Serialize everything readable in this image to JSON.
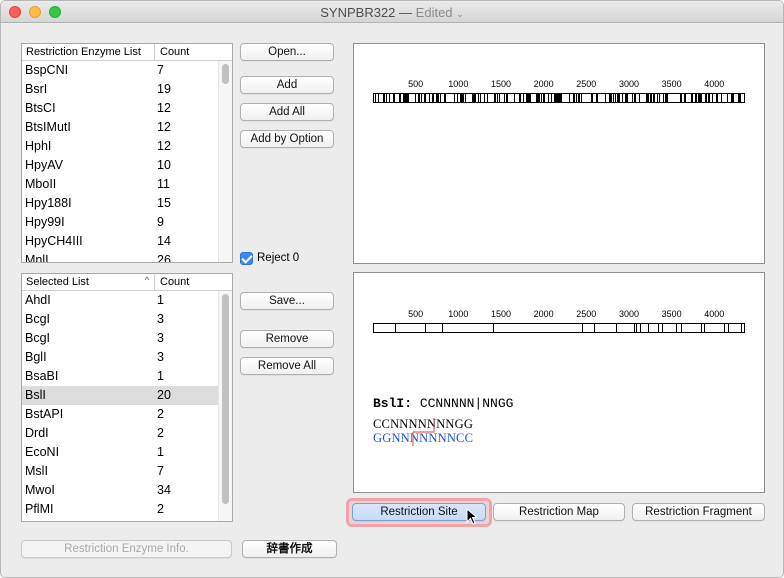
{
  "window": {
    "title": "SYNPBR322",
    "separator": "—",
    "status": "Edited",
    "status_chevron": "⌄"
  },
  "enzyme_list": {
    "headers": {
      "name": "Restriction Enzyme List",
      "count": "Count"
    },
    "rows": [
      {
        "name": "BspCNI",
        "count": "7"
      },
      {
        "name": "BsrI",
        "count": "19"
      },
      {
        "name": "BtsCI",
        "count": "12"
      },
      {
        "name": "BtsIMutI",
        "count": "12"
      },
      {
        "name": "HphI",
        "count": "12"
      },
      {
        "name": "HpyAV",
        "count": "10"
      },
      {
        "name": "MboII",
        "count": "11"
      },
      {
        "name": "Hpy188I",
        "count": "15"
      },
      {
        "name": "Hpy99I",
        "count": "9"
      },
      {
        "name": "HpyCH4III",
        "count": "14"
      },
      {
        "name": "MnlI",
        "count": "26"
      }
    ]
  },
  "selected_list": {
    "headers": {
      "name": "Selected List",
      "count": "Count",
      "sort_icon": "^"
    },
    "selected_index": 5,
    "rows": [
      {
        "name": "AhdI",
        "count": "1"
      },
      {
        "name": "BcgI",
        "count": "3"
      },
      {
        "name": "BcgI",
        "count": "3"
      },
      {
        "name": "BglI",
        "count": "3"
      },
      {
        "name": "BsaBI",
        "count": "1"
      },
      {
        "name": "BslI",
        "count": "20"
      },
      {
        "name": "BstAPI",
        "count": "2"
      },
      {
        "name": "DrdI",
        "count": "2"
      },
      {
        "name": "EcoNI",
        "count": "1"
      },
      {
        "name": "MslI",
        "count": "7"
      },
      {
        "name": "MwoI",
        "count": "34"
      },
      {
        "name": "PflMI",
        "count": "2"
      }
    ]
  },
  "buttons": {
    "open": "Open...",
    "add": "Add",
    "add_all": "Add All",
    "add_by_option": "Add by Option",
    "save": "Save...",
    "remove": "Remove",
    "remove_all": "Remove All",
    "restriction_site": "Restriction Site",
    "restriction_map": "Restriction Map",
    "restriction_fragment": "Restriction Fragment",
    "enzyme_info": "Restriction Enzyme Info.",
    "dictionary": "辞書作成"
  },
  "reject0": {
    "label": "Reject 0",
    "checked": true
  },
  "ruler_ticks": [
    "500",
    "1000",
    "1500",
    "2000",
    "2500",
    "3000",
    "3500",
    "4000"
  ],
  "map_top": {
    "sequence_length": 4360
  },
  "map_bottom": {
    "site_enzyme": "BslI:",
    "site_pattern": "CCNNNNN|NNGG",
    "top_strand": "CCNNNNNNNGG",
    "bottom_strand": "GGNNNNNNNCC"
  },
  "colors": {
    "accent": "#3b8af6",
    "bottom_strand": "#1a4fd6",
    "cut_mark": "#e0443e",
    "focus_ring": "#f1a4a8"
  }
}
